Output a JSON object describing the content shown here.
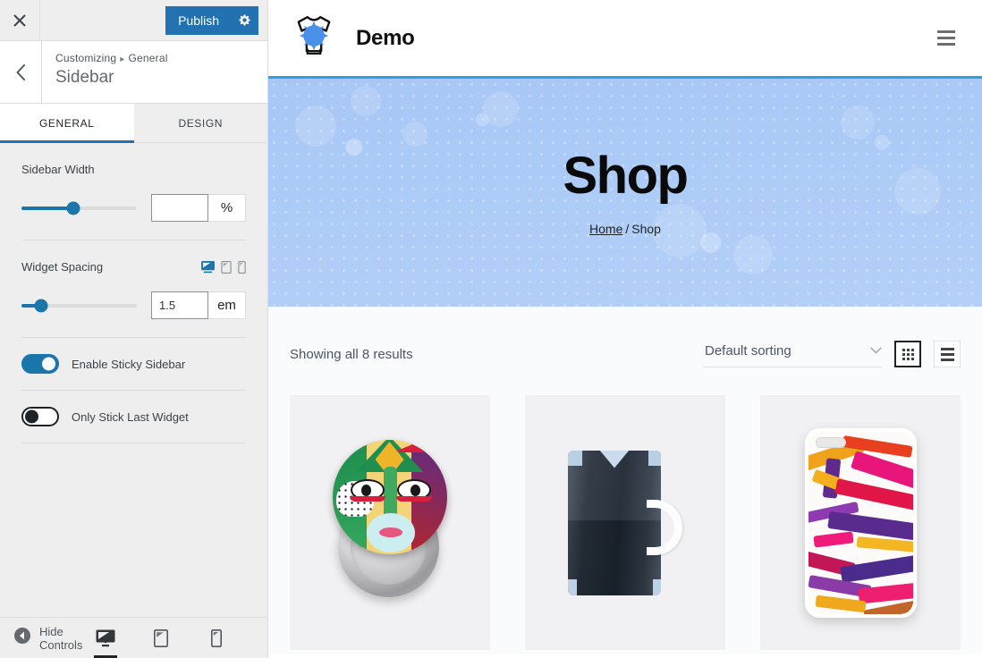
{
  "customizer": {
    "close_icon": "close-x-icon",
    "publish_label": "Publish",
    "publish_gear_icon": "gear-icon",
    "back_icon": "chevron-left-icon",
    "breadcrumb_root": "Customizing",
    "breadcrumb_separator": "▸",
    "breadcrumb_section": "General",
    "panel_title": "Sidebar",
    "tabs": [
      {
        "label": "GENERAL",
        "active": true
      },
      {
        "label": "DESIGN",
        "active": false
      }
    ],
    "controls": {
      "sidebar_width": {
        "label": "Sidebar Width",
        "value": "",
        "unit": "%",
        "slider_percent": 45
      },
      "widget_spacing": {
        "label": "Widget Spacing",
        "value": "1.5",
        "unit": "em",
        "slider_percent": 17,
        "devices": [
          {
            "name": "desktop-icon",
            "active": true
          },
          {
            "name": "tablet-icon",
            "active": false
          },
          {
            "name": "mobile-icon",
            "active": false
          }
        ]
      },
      "enable_sticky_sidebar": {
        "label": "Enable Sticky Sidebar",
        "on": true
      },
      "only_stick_last_widget": {
        "label": "Only Stick Last Widget",
        "on": false
      }
    },
    "footer": {
      "hide_controls_label": "Hide Controls",
      "hide_controls_icon": "collapse-arrow-icon",
      "devices": [
        {
          "name": "desktop-preview-icon",
          "active": true
        },
        {
          "name": "tablet-preview-icon",
          "active": false
        },
        {
          "name": "mobile-preview-icon",
          "active": false
        }
      ]
    },
    "colors": {
      "accent": "#2271b1",
      "slider": "#1b77ab",
      "panel_bg": "#eeeeee"
    }
  },
  "preview": {
    "header": {
      "logo_icon": "tshirt-splatter-logo",
      "brand": "Demo",
      "menu_icon": "hamburger-menu-icon"
    },
    "hero": {
      "title": "Shop",
      "breadcrumb_home": "Home",
      "breadcrumb_separator": "/",
      "breadcrumb_current": "Shop",
      "bg_color": "#accbf6"
    },
    "shop": {
      "result_count": "Showing all 8 results",
      "sorting_value": "Default sorting",
      "sorting_chevron_icon": "chevron-down-icon",
      "grid_view_icon": "grid-view-icon",
      "list_view_icon": "list-view-icon",
      "grid_view_active": true,
      "products": [
        {
          "name": "pin-badge-product"
        },
        {
          "name": "dark-mug-product"
        },
        {
          "name": "phone-case-product"
        }
      ]
    }
  }
}
